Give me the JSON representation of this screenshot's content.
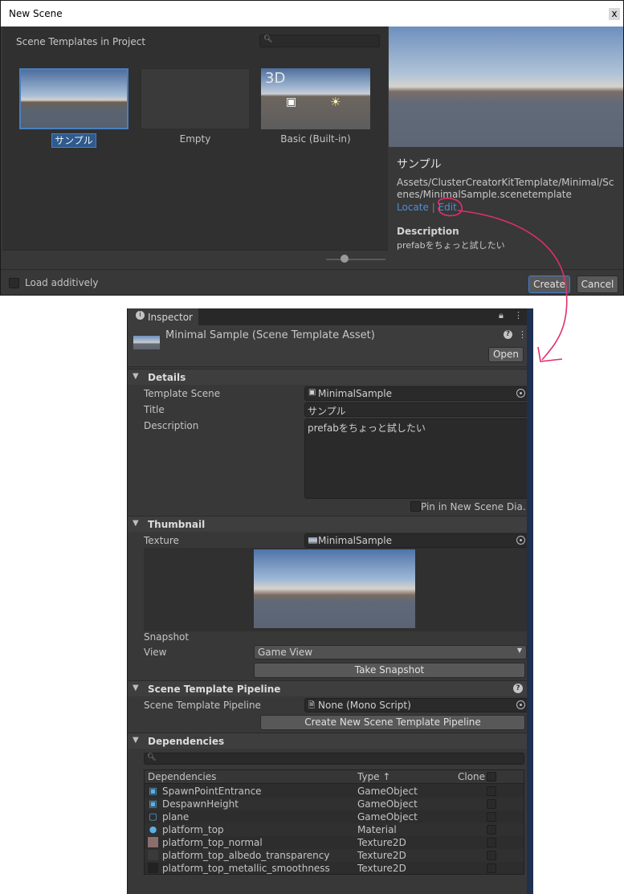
{
  "dialog": {
    "title": "New Scene",
    "close_glyph": "x",
    "header_label": "Scene Templates in Project",
    "search_icon": "search-icon",
    "templates": [
      {
        "label": "サンプル",
        "selected": true
      },
      {
        "label": "Empty",
        "selected": false
      },
      {
        "label": "Basic (Built-in)",
        "selected": false,
        "badge": "3D"
      }
    ],
    "preview": {
      "title": "サンプル",
      "path": "Assets/ClusterCreatorKitTemplate/Minimal/Scenes/MinimalSample.scenetemplate",
      "locate_label": "Locate",
      "separator": "|",
      "edit_label": "Edit",
      "description_heading": "Description",
      "description": "prefabをちょっと試したい"
    },
    "load_additively_label": "Load additively",
    "create_label": "Create",
    "cancel_label": "Cancel"
  },
  "inspector": {
    "tab_label": "Inspector",
    "asset_title": "Minimal Sample (Scene Template Asset)",
    "help_glyph": "?",
    "open_label": "Open",
    "details": {
      "heading": "Details",
      "template_scene_label": "Template Scene",
      "template_scene_value": "MinimalSample",
      "title_label": "Title",
      "title_value": "サンプル",
      "description_label": "Description",
      "description_value": "prefabをちょっと試したい",
      "pin_label": "Pin in New Scene Dia…"
    },
    "thumbnail": {
      "heading": "Thumbnail",
      "texture_label": "Texture",
      "texture_value": "MinimalSample",
      "snapshot_label": "Snapshot",
      "view_label": "View",
      "view_value": "Game View",
      "take_snapshot_label": "Take Snapshot"
    },
    "pipeline": {
      "heading": "Scene Template Pipeline",
      "label": "Scene Template Pipeline",
      "value": "None (Mono Script)",
      "create_label": "Create New Scene Template Pipeline"
    },
    "dependencies": {
      "heading": "Dependencies",
      "col_name": "Dependencies",
      "col_type": "Type ↑",
      "col_clone": "Clone",
      "rows": [
        {
          "name": "SpawnPointEntrance",
          "type": "GameObject",
          "icon": "prefab-icon",
          "color": "#5ab0e8"
        },
        {
          "name": "DespawnHeight",
          "type": "GameObject",
          "icon": "prefab-icon",
          "color": "#5ab0e8"
        },
        {
          "name": "plane",
          "type": "GameObject",
          "icon": "model-icon",
          "color": "#5ab0e8"
        },
        {
          "name": "platform_top",
          "type": "Material",
          "icon": "material-icon",
          "color": "#5ab0e8"
        },
        {
          "name": "platform_top_normal",
          "type": "Texture2D",
          "icon": "texture-icon",
          "color": "#8a6e6e"
        },
        {
          "name": "platform_top_albedo_transparency",
          "type": "Texture2D",
          "icon": "texture-icon",
          "color": "#3a3a3a"
        },
        {
          "name": "platform_top_metallic_smoothness",
          "type": "Texture2D",
          "icon": "texture-icon",
          "color": "#222222"
        }
      ]
    }
  },
  "colors": {
    "annotation": "#e0306a",
    "link": "#4f8ed8",
    "selection": "#2e5a8e"
  }
}
